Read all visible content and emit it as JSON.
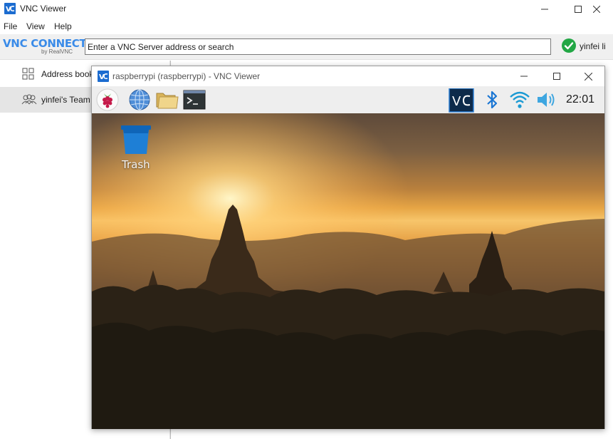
{
  "outer_window": {
    "title": "VNC Viewer",
    "menu": [
      "File",
      "View",
      "Help"
    ]
  },
  "toolbar": {
    "logo_main": "VNC CONNECT",
    "logo_sub": "by RealVNC",
    "address_placeholder": "Enter a VNC Server address or search",
    "address_value": "",
    "user_name": "yinfei li",
    "status_icon": "check-circle-icon"
  },
  "sidebar": {
    "items": [
      {
        "label": "Address book",
        "icon": "grid-icon",
        "selected": false
      },
      {
        "label": "yinfei's Team",
        "icon": "team-icon",
        "selected": true
      }
    ]
  },
  "session_window": {
    "title": "raspberrypi (raspberrypi) - VNC Viewer"
  },
  "pi_panel": {
    "launchers": [
      "raspberry-menu-icon",
      "web-browser-icon",
      "file-manager-icon",
      "terminal-icon"
    ],
    "tray": [
      "vnc-server-icon",
      "bluetooth-icon",
      "wifi-icon",
      "volume-icon"
    ],
    "clock": "22:01"
  },
  "desktop": {
    "icons": [
      {
        "label": "Trash",
        "icon": "trash-icon"
      }
    ]
  },
  "colors": {
    "accent": "#3a8be8",
    "status_ok": "#22a745",
    "vnc_tray_bg": "#0d2a4a",
    "selected_row": "#e5e5e5"
  }
}
